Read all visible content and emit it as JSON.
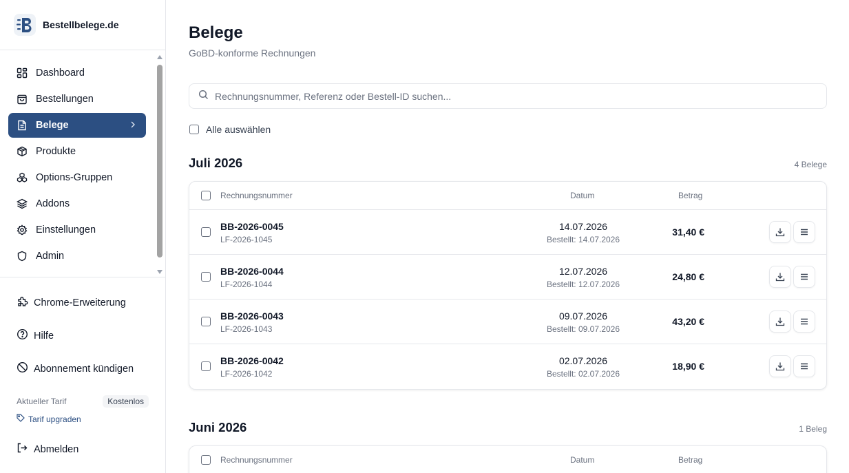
{
  "brand": {
    "name": "Bestellbelege.de"
  },
  "nav": {
    "items": [
      {
        "label": "Dashboard",
        "icon": "dashboard-icon"
      },
      {
        "label": "Bestellungen",
        "icon": "shopping-bag-icon"
      },
      {
        "label": "Belege",
        "icon": "document-icon",
        "active": true
      },
      {
        "label": "Produkte",
        "icon": "package-icon"
      },
      {
        "label": "Options-Gruppen",
        "icon": "options-group-icon"
      },
      {
        "label": "Addons",
        "icon": "layers-icon"
      },
      {
        "label": "Einstellungen",
        "icon": "gear-icon"
      },
      {
        "label": "Admin",
        "icon": "shield-icon"
      }
    ]
  },
  "utility": {
    "chrome": "Chrome-Erweiterung",
    "help": "Hilfe",
    "cancel": "Abonnement kündigen",
    "logout": "Abmelden"
  },
  "tarif": {
    "label": "Aktueller Tarif",
    "value": "Kostenlos",
    "upgrade": "Tarif upgraden"
  },
  "page": {
    "title": "Belege",
    "subtitle": "GoBD-konforme Rechnungen",
    "search_placeholder": "Rechnungsnummer, Referenz oder Bestell-ID suchen...",
    "select_all": "Alle auswählen"
  },
  "columns": {
    "number": "Rechnungsnummer",
    "date": "Datum",
    "amount": "Betrag"
  },
  "groups": [
    {
      "month": "Juli 2026",
      "count": "4 Belege",
      "rows": [
        {
          "number": "BB-2026-0045",
          "ref": "LF-2026-1045",
          "date": "14.07.2026",
          "ordered": "Bestellt: 14.07.2026",
          "amount": "31,40 €"
        },
        {
          "number": "BB-2026-0044",
          "ref": "LF-2026-1044",
          "date": "12.07.2026",
          "ordered": "Bestellt: 12.07.2026",
          "amount": "24,80 €"
        },
        {
          "number": "BB-2026-0043",
          "ref": "LF-2026-1043",
          "date": "09.07.2026",
          "ordered": "Bestellt: 09.07.2026",
          "amount": "43,20 €"
        },
        {
          "number": "BB-2026-0042",
          "ref": "LF-2026-1042",
          "date": "02.07.2026",
          "ordered": "Bestellt: 02.07.2026",
          "amount": "18,90 €"
        }
      ]
    },
    {
      "month": "Juni 2026",
      "count": "1 Beleg",
      "rows": []
    }
  ],
  "colors": {
    "accent": "#2c4f82",
    "border": "#e5e7eb",
    "muted": "#6b7280"
  }
}
